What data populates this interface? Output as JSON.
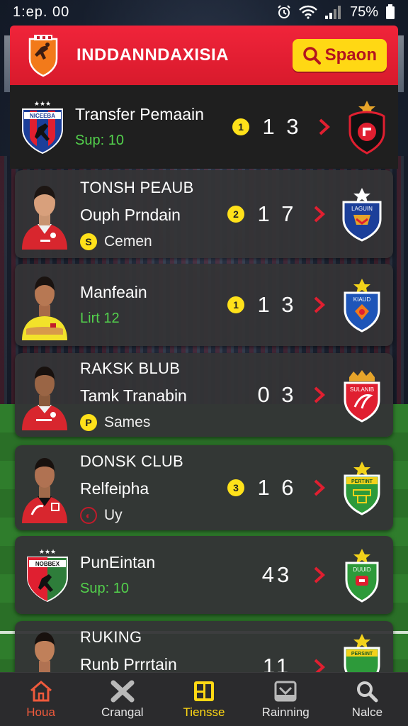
{
  "status_bar": {
    "time": "1:ep. 00",
    "battery": "75%"
  },
  "header": {
    "title": "INDDANNDAXISIA",
    "search_label": "Spaon"
  },
  "rows": [
    {
      "line1": "Transfer Pemaain",
      "line2": "Sup: 10",
      "rank": "1",
      "score": "1 3"
    },
    {
      "line1": "TONSH PEAUB",
      "line2": "Ouph Prndain",
      "chip_icon": "S",
      "chip_text": "Cemen",
      "rank": "2",
      "score": "1 7"
    },
    {
      "line1": "Manfeain",
      "line2": "Lirt 12",
      "rank": "1",
      "score": "1 3"
    },
    {
      "line1": "RAKSK BLUB",
      "line2": "Tamk Tranabin",
      "chip_icon": "P",
      "chip_text": "Sames",
      "score": "0 3"
    },
    {
      "line1": "DONSK CLUB",
      "line2": "Relfeipha",
      "chip_text": "Uy",
      "rank": "3",
      "score": "1 6"
    },
    {
      "line1": "PunEintan",
      "line2": "Sup: 10",
      "score": "43"
    },
    {
      "line1": "RUKING",
      "line2": "Runb Prrrtain",
      "score": "11"
    }
  ],
  "crest_texts": {
    "left_1": "NICEEBA",
    "left_6": "NOBBEX",
    "right_2": "LAGUIN",
    "right_3": "KIAUD",
    "right_4": "SULANIB",
    "right_5": "PERTINT",
    "right_6": "DUUID",
    "right_7": "PERSINT"
  },
  "bottom_nav": [
    {
      "label": "Houa",
      "icon": "home-icon"
    },
    {
      "label": "Crangal",
      "icon": "cross-icon"
    },
    {
      "label": "Tiensse",
      "icon": "shop-icon"
    },
    {
      "label": "Rainning",
      "icon": "training-icon"
    },
    {
      "label": "Nalce",
      "icon": "search-icon"
    }
  ],
  "colors": {
    "accent_red": "#e01f30",
    "accent_yellow": "#ffd814",
    "green_text": "#53d14c",
    "nav_bg": "#2b2b2d"
  }
}
